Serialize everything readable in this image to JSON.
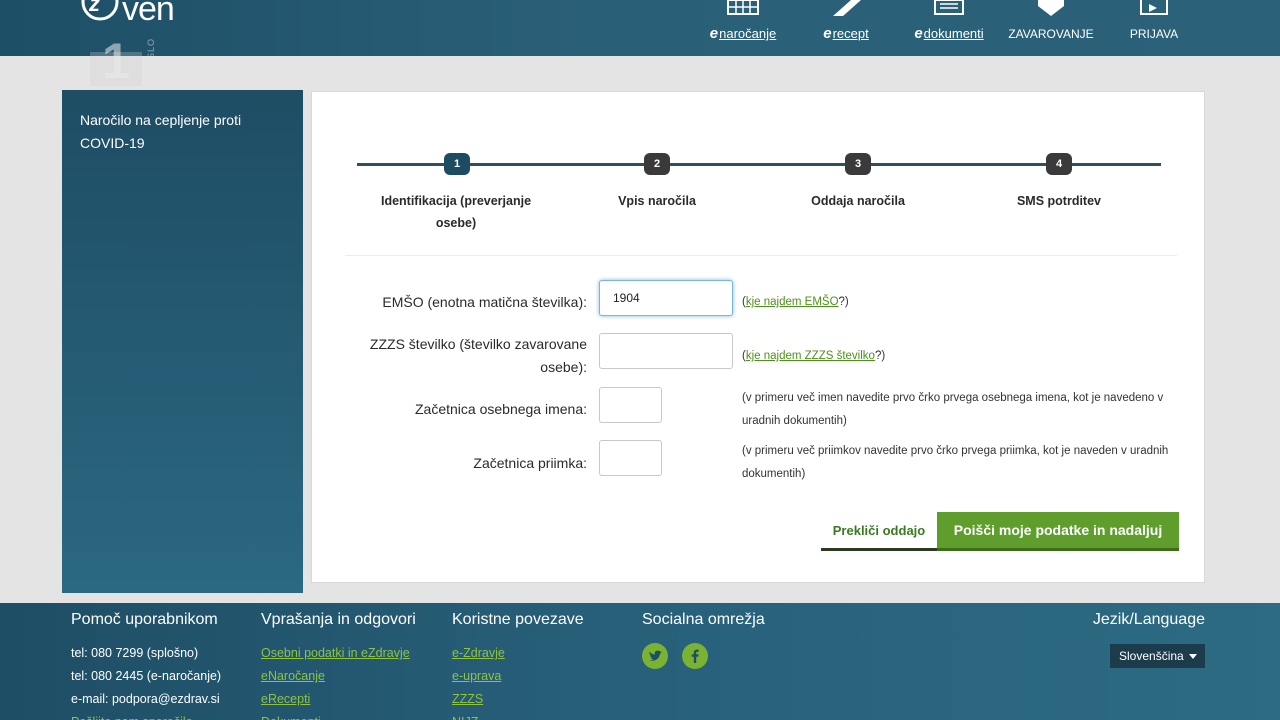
{
  "header": {
    "logo_text": "ven",
    "channel": {
      "number": "1",
      "text": "TV SLO"
    },
    "nav": [
      {
        "prefix": "e",
        "label": "naročanje",
        "icon": "calendar-icon"
      },
      {
        "prefix": "e",
        "label": "recept",
        "icon": "pill-icon"
      },
      {
        "prefix": "e",
        "label": "dokumenti",
        "icon": "document-icon"
      },
      {
        "prefix": "",
        "label": "ZAVAROVANJE",
        "icon": "shield-icon"
      },
      {
        "prefix": "",
        "label": "PRIJAVA",
        "icon": "login-icon"
      }
    ]
  },
  "sidebar": {
    "title": "Naročilo na cepljenje proti COVID-19"
  },
  "steps": [
    {
      "number": "1",
      "label": "Identifikacija (preverjanje osebe)",
      "active": true
    },
    {
      "number": "2",
      "label": "Vpis naročila",
      "active": false
    },
    {
      "number": "3",
      "label": "Oddaja naročila",
      "active": false
    },
    {
      "number": "4",
      "label": "SMS potrditev",
      "active": false
    }
  ],
  "form": {
    "emso": {
      "label": "EMŠO (enotna matična številka):",
      "value": "1904",
      "hint_open": "(",
      "hint_link": "kje najdem EMŠO",
      "hint_close": "?)"
    },
    "zzzs": {
      "label": "ZZZS številko (številko zavarovane osebe):",
      "value": "",
      "hint_open": "(",
      "hint_link": "kje najdem ZZZS številko",
      "hint_close": "?)"
    },
    "first_initial": {
      "label": "Začetnica osebnega imena:",
      "value": "",
      "hint": "(v primeru več imen navedite prvo črko prvega osebnega imena, kot je navedeno v uradnih dokumentih)"
    },
    "last_initial": {
      "label": "Začetnica priimka:",
      "value": "",
      "hint": "(v primeru več priimkov navedite prvo črko prvega priimka, kot je naveden v uradnih dokumentih)"
    },
    "cancel_label": "Prekliči oddajo",
    "submit_label": "Poišči moje podatke in nadaljuj"
  },
  "footer": {
    "help": {
      "title": "Pomoč uporabnikom",
      "lines": [
        "tel: 080 7299 (splošno)",
        "tel: 080 2445 (e-naročanje)",
        "e-mail: podpora@ezdrav.si",
        "Pošljite nam sporočilo"
      ]
    },
    "faq": {
      "title": "Vprašanja in odgovori",
      "links": [
        "Osebni podatki in eZdravje",
        "eNaročanje",
        "eRecepti",
        "Dokumenti"
      ]
    },
    "links": {
      "title": "Koristne povezave",
      "links": [
        "e-Zdravje",
        "e-uprava",
        "ZZZS",
        "NIJZ"
      ]
    },
    "social": {
      "title": "Socialna omrežja",
      "icons": [
        "twitter-icon",
        "facebook-icon"
      ]
    },
    "language": {
      "title": "Jezik/Language",
      "selected": "Slovenščina"
    }
  },
  "colors": {
    "brand_dark": "#1d4f66",
    "accent_green": "#5f9e2d",
    "link_green": "#4f8f1c"
  }
}
